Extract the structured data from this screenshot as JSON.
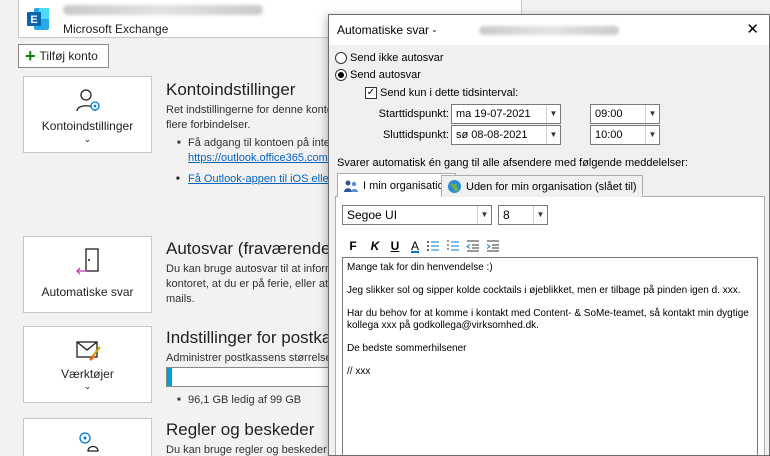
{
  "account": {
    "type": "Microsoft Exchange",
    "add_account_label": "Tilføj konto"
  },
  "sections": {
    "account_settings": {
      "tile_label": "Kontoindstillinger",
      "title": "Kontoindstillinger",
      "text1": "Ret indstillingerne for denne konto",
      "text2": "flere forbindelser.",
      "bullet1": "Få adgang til kontoen på inte",
      "link1": "https://outlook.office365.com",
      "link2": "Få Outlook-appen til iOS eller"
    },
    "auto_reply": {
      "tile_label": "Automatiske svar",
      "title": "Autosvar (fraværende)",
      "text1": "Du kan bruge autosvar til at inform",
      "text2": "kontoret, at du er på ferie, eller at",
      "text3": "mails."
    },
    "tools": {
      "tile_label": "Værktøjer",
      "title": "Indstillinger for postkas",
      "text1": "Administrer postkassens størrelse v",
      "storage_text": "96,1 GB ledig af 99 GB",
      "storage_used_fraction": 0.03
    },
    "rules": {
      "title": "Regler og beskeder",
      "text1": "Du kan bruge regler og beskeder"
    }
  },
  "dialog": {
    "title": "Automatiske svar -",
    "close_symbol": "✕",
    "radio_off": "Send ikke autosvar",
    "radio_on": "Send autosvar",
    "check_interval": "Send kun i dette tidsinterval:",
    "start_label": "Starttidspunkt:",
    "end_label": "Sluttidspunkt:",
    "start_date": "ma 19-07-2021",
    "end_date": "sø 08-08-2021",
    "start_time": "09:00",
    "end_time": "10:00",
    "info": "Svarer automatisk én gang til alle afsendere med følgende meddelelser:",
    "tab_inside": "I min organisation",
    "tab_outside": "Uden for min organisation (slået til)",
    "font_name": "Segoe UI",
    "font_size": "8",
    "fmt_bold": "F",
    "fmt_italic": "K",
    "fmt_underline": "U",
    "fmt_color": "A",
    "message": {
      "line1": "Mange tak for din henvendelse :)",
      "line2": "Jeg slikker sol og sipper kolde cocktails i øjeblikket, men er tilbage på pinden igen d. xxx.",
      "line3a": "Har du behov for at komme i kontakt med Content- & SoMe-teamet, så kontakt min dygtige",
      "line3b": "kollega xxx på godkollega@virksomhed.dk.",
      "line4": "De bedste sommerhilsener",
      "line5": "// xxx"
    }
  }
}
